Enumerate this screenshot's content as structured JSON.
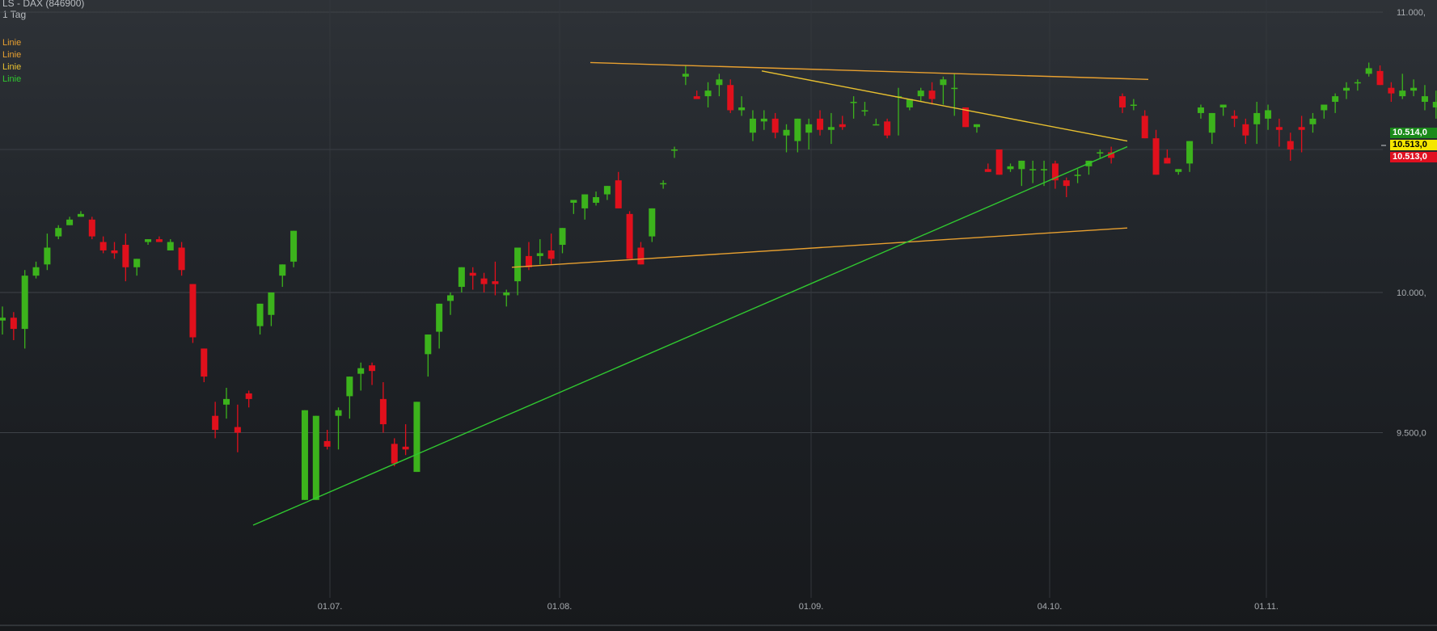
{
  "header": {
    "title": "LS - DAX (846900)",
    "interval": "1 Tag"
  },
  "legend": [
    {
      "label": "Linie",
      "color": "#e8a030"
    },
    {
      "label": "Linie",
      "color": "#e8a030"
    },
    {
      "label": "Linie",
      "color": "#e8c030"
    },
    {
      "label": "Linie",
      "color": "#30c830"
    }
  ],
  "price_badges": [
    {
      "text": "10.514,0",
      "bg": "#1a8a1a",
      "fg": "#ffffff"
    },
    {
      "text": "10.513,0",
      "bg": "#f5e600",
      "fg": "#000000"
    },
    {
      "text": "10.513,0",
      "bg": "#e01020",
      "fg": "#ffffff"
    }
  ],
  "chart_data": {
    "type": "candlestick",
    "y_tick_labels": [
      "11.000,",
      "10.000,",
      "9.500,0"
    ],
    "y_ticks": [
      11000,
      10000,
      9500
    ],
    "x_tick_labels": [
      "01.07.",
      "01.08.",
      "01.09.",
      "04.10.",
      "01.11."
    ],
    "ylim": [
      9000,
      11040
    ],
    "colors": {
      "up": "#3cb31c",
      "down": "#e0101c"
    },
    "candles": [
      [
        9900,
        9950,
        9850,
        9910
      ],
      [
        9910,
        9930,
        9830,
        9870
      ],
      [
        9870,
        10080,
        9800,
        10060
      ],
      [
        10060,
        10110,
        10050,
        10090
      ],
      [
        10100,
        10210,
        10080,
        10160
      ],
      [
        10200,
        10240,
        10190,
        10230
      ],
      [
        10240,
        10270,
        10240,
        10260
      ],
      [
        10270,
        10290,
        10270,
        10280
      ],
      [
        10260,
        10270,
        10190,
        10200
      ],
      [
        10180,
        10200,
        10140,
        10150
      ],
      [
        10150,
        10180,
        10120,
        10140
      ],
      [
        10170,
        10210,
        10040,
        10090
      ],
      [
        10090,
        10110,
        10060,
        10120
      ],
      [
        10180,
        10190,
        10170,
        10190
      ],
      [
        10190,
        10200,
        10180,
        10180
      ],
      [
        10150,
        10190,
        10160,
        10180
      ],
      [
        10160,
        10180,
        10060,
        10080
      ],
      [
        10030,
        10000,
        9820,
        9840
      ],
      [
        9800,
        9770,
        9680,
        9700
      ],
      [
        9560,
        9610,
        9480,
        9510
      ],
      [
        9600,
        9660,
        9550,
        9620
      ],
      [
        9520,
        9600,
        9430,
        9500
      ],
      [
        9640,
        9650,
        9590,
        9620
      ],
      [
        9880,
        9940,
        9850,
        9960
      ],
      [
        9920,
        9990,
        9880,
        10000
      ],
      [
        10060,
        10080,
        10020,
        10100
      ],
      [
        10110,
        10150,
        10090,
        10220
      ],
      [
        9260,
        9280,
        9260,
        9580
      ],
      [
        9260,
        9280,
        9260,
        9560
      ],
      [
        9470,
        9510,
        9440,
        9450
      ],
      [
        9560,
        9590,
        9440,
        9580
      ],
      [
        9630,
        9670,
        9550,
        9700
      ],
      [
        9710,
        9750,
        9650,
        9730
      ],
      [
        9740,
        9750,
        9670,
        9720
      ],
      [
        9620,
        9680,
        9500,
        9530
      ],
      [
        9460,
        9480,
        9380,
        9390
      ],
      [
        9450,
        9530,
        9420,
        9440
      ],
      [
        9360,
        9360,
        9660,
        9610
      ],
      [
        9780,
        9810,
        9700,
        9850
      ],
      [
        9860,
        9890,
        9800,
        9960
      ],
      [
        9970,
        10000,
        9920,
        9990
      ],
      [
        10020,
        10060,
        10000,
        10090
      ],
      [
        10070,
        10090,
        10010,
        10060
      ],
      [
        10050,
        10070,
        10000,
        10030
      ],
      [
        10040,
        10110,
        9990,
        10030
      ],
      [
        9990,
        10010,
        9950,
        10000
      ],
      [
        10040,
        10130,
        9990,
        10160
      ],
      [
        10130,
        10180,
        10080,
        10090
      ],
      [
        10130,
        10190,
        10100,
        10140
      ],
      [
        10150,
        10210,
        10100,
        10120
      ],
      [
        10170,
        10220,
        10140,
        10230
      ],
      [
        10320,
        10330,
        10280,
        10330
      ],
      [
        10300,
        10350,
        10260,
        10350
      ],
      [
        10320,
        10360,
        10310,
        10340
      ],
      [
        10350,
        10370,
        10330,
        10380
      ],
      [
        10400,
        10430,
        10340,
        10300
      ],
      [
        10280,
        10290,
        10150,
        10120
      ],
      [
        10160,
        10180,
        10130,
        10100
      ],
      [
        10200,
        10250,
        10180,
        10300
      ],
      [
        10390,
        10400,
        10370,
        10390
      ],
      [
        10510,
        10520,
        10480,
        10510
      ],
      [
        10770,
        10810,
        10740,
        10780
      ],
      [
        10700,
        10720,
        10690,
        10690
      ],
      [
        10700,
        10750,
        10660,
        10720
      ],
      [
        10740,
        10780,
        10700,
        10760
      ],
      [
        10740,
        10760,
        10640,
        10650
      ],
      [
        10650,
        10700,
        10630,
        10660
      ],
      [
        10570,
        10650,
        10540,
        10620
      ],
      [
        10610,
        10650,
        10580,
        10620
      ],
      [
        10620,
        10640,
        10550,
        10570
      ],
      [
        10560,
        10600,
        10500,
        10580
      ],
      [
        10540,
        10590,
        10500,
        10620
      ],
      [
        10570,
        10620,
        10510,
        10600
      ],
      [
        10620,
        10650,
        10560,
        10580
      ],
      [
        10580,
        10640,
        10530,
        10590
      ],
      [
        10600,
        10630,
        10580,
        10590
      ],
      [
        10680,
        10700,
        10620,
        10680
      ],
      [
        10650,
        10680,
        10630,
        10650
      ],
      [
        10600,
        10620,
        10600,
        10600
      ],
      [
        10610,
        10620,
        10550,
        10560
      ],
      [
        10700,
        10730,
        10560,
        10700
      ],
      [
        10660,
        10690,
        10650,
        10690
      ],
      [
        10700,
        10730,
        10680,
        10720
      ],
      [
        10720,
        10750,
        10670,
        10690
      ],
      [
        10740,
        10770,
        10670,
        10760
      ],
      [
        10730,
        10780,
        10630,
        10730
      ],
      [
        10660,
        10660,
        10600,
        10590
      ],
      [
        10590,
        10600,
        10570,
        10600
      ],
      [
        10440,
        10460,
        10450,
        10430
      ],
      [
        10510,
        10480,
        10420,
        10420
      ],
      [
        10440,
        10460,
        10430,
        10450
      ],
      [
        10440,
        10460,
        10380,
        10470
      ],
      [
        10440,
        10470,
        10390,
        10440
      ],
      [
        10440,
        10470,
        10380,
        10440
      ],
      [
        10460,
        10470,
        10370,
        10400
      ],
      [
        10400,
        10410,
        10340,
        10380
      ],
      [
        10420,
        10440,
        10390,
        10420
      ],
      [
        10450,
        10460,
        10420,
        10470
      ],
      [
        10500,
        10510,
        10480,
        10500
      ],
      [
        10500,
        10520,
        10460,
        10480
      ],
      [
        10700,
        10710,
        10640,
        10660
      ],
      [
        10670,
        10690,
        10650,
        10670
      ],
      [
        10630,
        10650,
        10620,
        10550
      ],
      [
        10550,
        10580,
        10450,
        10420
      ],
      [
        10480,
        10510,
        10470,
        10460
      ],
      [
        10430,
        10440,
        10420,
        10440
      ],
      [
        10460,
        10470,
        10430,
        10540
      ],
      [
        10640,
        10670,
        10620,
        10660
      ],
      [
        10570,
        10620,
        10530,
        10640
      ],
      [
        10660,
        10670,
        10630,
        10670
      ],
      [
        10630,
        10650,
        10590,
        10620
      ],
      [
        10600,
        10620,
        10530,
        10560
      ],
      [
        10600,
        10680,
        10530,
        10640
      ],
      [
        10620,
        10670,
        10580,
        10650
      ],
      [
        10590,
        10620,
        10520,
        10580
      ],
      [
        10540,
        10570,
        10470,
        10510
      ],
      [
        10590,
        10630,
        10500,
        10580
      ],
      [
        10600,
        10640,
        10570,
        10620
      ],
      [
        10650,
        10670,
        10620,
        10670
      ],
      [
        10680,
        10710,
        10640,
        10700
      ],
      [
        10720,
        10750,
        10690,
        10730
      ],
      [
        10750,
        10760,
        10720,
        10750
      ],
      [
        10780,
        10820,
        10770,
        10800
      ],
      [
        10790,
        10810,
        10740,
        10740
      ],
      [
        10730,
        10750,
        10680,
        10710
      ],
      [
        10700,
        10780,
        10690,
        10720
      ],
      [
        10720,
        10760,
        10700,
        10730
      ],
      [
        10680,
        10740,
        10650,
        10700
      ],
      [
        10660,
        10720,
        10620,
        10680
      ],
      [
        10730,
        10750,
        10540,
        10530
      ]
    ],
    "trendlines": [
      {
        "name": "Linie",
        "color": "#e8a030",
        "points": [
          [
            633,
            10090
          ],
          [
            1394,
            10230
          ]
        ]
      },
      {
        "name": "Linie",
        "color": "#e8a030",
        "points": [
          [
            730,
            10820
          ],
          [
            1420,
            10760
          ]
        ]
      },
      {
        "name": "Linie",
        "color": "#e8c030",
        "points": [
          [
            942,
            10790
          ],
          [
            1394,
            10540
          ]
        ]
      },
      {
        "name": "Linie",
        "color": "#30c830",
        "points": [
          [
            313,
            9170
          ],
          [
            1394,
            10520
          ]
        ]
      }
    ]
  }
}
